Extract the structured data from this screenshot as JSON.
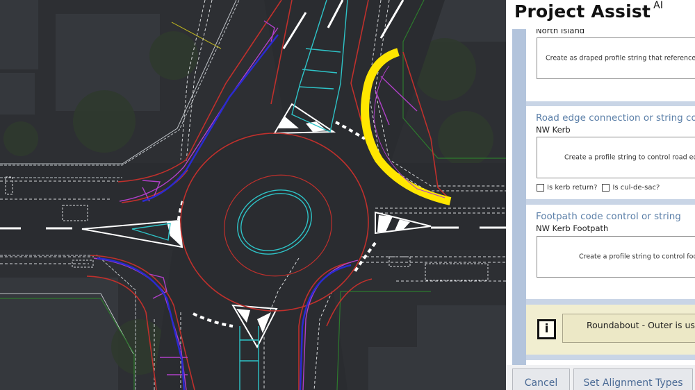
{
  "app": {
    "title": "Project Assist",
    "title_suffix": "AI"
  },
  "panel": {
    "sections": [
      {
        "title": "",
        "subtitle": "North Island",
        "action_text": "Create as draped profile string that references a"
      },
      {
        "title": "Road edge connection or string control",
        "subtitle": "NW Kerb",
        "action_text": "Create a profile string to control road edge",
        "checkboxes": [
          {
            "label": "Is kerb return?",
            "checked": false
          },
          {
            "label": "Is cul-de-sac?",
            "checked": false
          }
        ]
      },
      {
        "title": "Footpath code control or string",
        "subtitle": "NW Kerb Footpath",
        "action_text": "Create a profile string to control footpath"
      }
    ],
    "info": {
      "icon": "info-icon",
      "icon_glyph": "i",
      "message": "Roundabout - Outer is used"
    },
    "buttons": {
      "cancel": "Cancel",
      "set_alignment_types": "Set Alignment Types"
    }
  },
  "map": {
    "description": "Aerial CAD view of a roundabout intersection",
    "colors": {
      "road": "#2e3034",
      "kerb_red": "#c0302c",
      "island_cyan": "#2ec4c8",
      "selection_yellow": "#ffe600",
      "magenta": "#b040c8",
      "blue": "#2a2ad0",
      "green": "#2d7a2d",
      "marking_white": "#ffffff"
    }
  }
}
